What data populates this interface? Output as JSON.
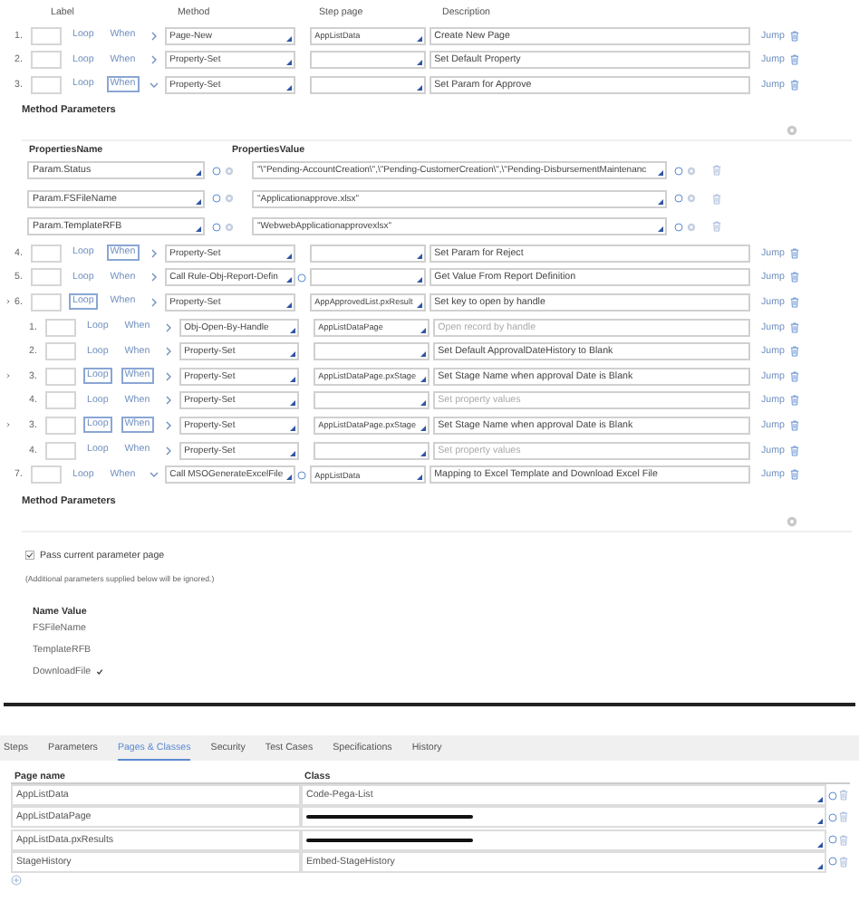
{
  "step_columns": [
    "Label",
    "Method",
    "Step page",
    "Description"
  ],
  "steps": [
    {
      "number": "1.",
      "loop": "Loop",
      "when": "When",
      "loop_boxed": false,
      "when_boxed": false,
      "expanded": false,
      "flagged": false,
      "method": "Page-New",
      "method_button": false,
      "step_page": "AppListData",
      "description": "Create New Page",
      "jump": "Jump"
    },
    {
      "number": "2.",
      "loop": "Loop",
      "when": "When",
      "loop_boxed": false,
      "when_boxed": false,
      "expanded": false,
      "flagged": false,
      "method": "Property-Set",
      "method_button": false,
      "description": "Set Default Property",
      "jump": "Jump"
    },
    {
      "number": "3.",
      "loop": "Loop",
      "when": "When",
      "loop_boxed": false,
      "when_boxed": true,
      "expanded": true,
      "flagged": false,
      "method": "Property-Set",
      "method_button": false,
      "description": "Set Param for Approve",
      "jump": "Jump",
      "parameters": {
        "kind": "properties",
        "title": "Method Parameters",
        "name_header": "PropertiesName",
        "value_header": "PropertiesValue",
        "rows": [
          {
            "name": "Param.Status",
            "value": "\"\\\"Pending-AccountCreation\\\",\\\"Pending-CustomerCreation\\\",\\\"Pending-DisbursementMaintenanc"
          },
          {
            "name": "Param.FSFileName",
            "value": "\"Applicationapprove.xlsx\""
          },
          {
            "name": "Param.TemplateRFB",
            "value": "\"WebwebApplicationapprovexlsx\""
          }
        ]
      }
    },
    {
      "number": "4.",
      "loop": "Loop",
      "when": "When",
      "loop_boxed": false,
      "when_boxed": true,
      "expanded": false,
      "flagged": false,
      "method": "Property-Set",
      "method_button": false,
      "description": "Set Param for Reject",
      "jump": "Jump"
    },
    {
      "number": "5.",
      "loop": "Loop",
      "when": "When",
      "loop_boxed": false,
      "when_boxed": false,
      "expanded": false,
      "flagged": false,
      "method": "Call Rule-Obj-Report-Defin",
      "method_button": true,
      "description": "Get Value From Report Definition",
      "jump": "Jump"
    },
    {
      "number": "6.",
      "loop": "Loop",
      "when": "When",
      "loop_boxed": true,
      "when_boxed": false,
      "expanded": false,
      "flagged": true,
      "method": "Property-Set",
      "method_button": false,
      "step_page": "AppApprovedList.pxResult",
      "description": "Set key to open by handle",
      "jump": "Jump",
      "children": [
        {
          "number": "1.",
          "loop": "Loop",
          "when": "When",
          "loop_boxed": false,
          "when_boxed": false,
          "expanded": false,
          "flagged": false,
          "method": "Obj-Open-By-Handle",
          "method_button": false,
          "step_page": "AppListDataPage",
          "description_placeholder": "Open record by handle",
          "jump": "Jump"
        },
        {
          "number": "2.",
          "loop": "Loop",
          "when": "When",
          "loop_boxed": false,
          "when_boxed": false,
          "expanded": false,
          "flagged": false,
          "method": "Property-Set",
          "method_button": false,
          "description": "Set Default ApprovalDateHistory to Blank",
          "jump": "Jump"
        },
        {
          "number": "3.",
          "loop": "Loop",
          "when": "When",
          "loop_boxed": true,
          "when_boxed": true,
          "expanded": false,
          "flagged": true,
          "method": "Property-Set",
          "method_button": false,
          "step_page": "AppListDataPage.pxStage",
          "description": "Set Stage Name when approval Date is Blank",
          "jump": "Jump"
        },
        {
          "number": "4.",
          "loop": "Loop",
          "when": "When",
          "loop_boxed": false,
          "when_boxed": false,
          "expanded": false,
          "flagged": false,
          "method": "Property-Set",
          "method_button": false,
          "description_placeholder": "Set property values",
          "jump": "Jump"
        },
        {
          "number": "3.",
          "loop": "Loop",
          "when": "When",
          "loop_boxed": true,
          "when_boxed": true,
          "expanded": false,
          "flagged": true,
          "method": "Property-Set",
          "method_button": false,
          "step_page": "AppListDataPage.pxStage",
          "description": "Set Stage Name when approval Date is Blank",
          "jump": "Jump"
        },
        {
          "number": "4.",
          "loop": "Loop",
          "when": "When",
          "loop_boxed": false,
          "when_boxed": false,
          "expanded": false,
          "flagged": false,
          "method": "Property-Set",
          "method_button": false,
          "description_placeholder": "Set property values",
          "jump": "Jump"
        }
      ]
    },
    {
      "number": "7.",
      "loop": "Loop",
      "when": "When",
      "loop_boxed": false,
      "when_boxed": false,
      "expanded": true,
      "flagged": false,
      "method": "Call MSOGenerateExcelFile",
      "method_button": true,
      "step_page": "AppListData",
      "description": "Mapping to Excel Template and Download Excel File",
      "jump": "Jump",
      "parameters": {
        "kind": "arguments",
        "title": "Method Parameters",
        "pass_label": "Pass current parameter page",
        "pass_checked": true,
        "note": "(Additional parameters supplied below will be ignored.)",
        "columns": [
          "Name",
          "Value"
        ],
        "rows": [
          {
            "name": "FSFileName",
            "checked": false
          },
          {
            "name": "TemplateRFB",
            "checked": false
          },
          {
            "name": "DownloadFile",
            "checked": true
          }
        ]
      }
    }
  ],
  "tabs": [
    {
      "label": "Steps",
      "selected": false
    },
    {
      "label": "Parameters",
      "selected": false
    },
    {
      "label": "Pages & Classes",
      "selected": true
    },
    {
      "label": "Security",
      "selected": false
    },
    {
      "label": "Test Cases",
      "selected": false
    },
    {
      "label": "Specifications",
      "selected": false
    },
    {
      "label": "History",
      "selected": false
    }
  ],
  "pages_table": {
    "columns": [
      "Page name",
      "Class"
    ],
    "rows": [
      {
        "page_name": "AppListData",
        "class": "Code-Pega-List",
        "redacted": false
      },
      {
        "page_name": "AppListDataPage",
        "redacted": true
      },
      {
        "page_name": "AppListData.pxResults",
        "redacted": true
      },
      {
        "page_name": "StageHistory",
        "class": "Embed-StageHistory",
        "redacted": false
      }
    ]
  }
}
